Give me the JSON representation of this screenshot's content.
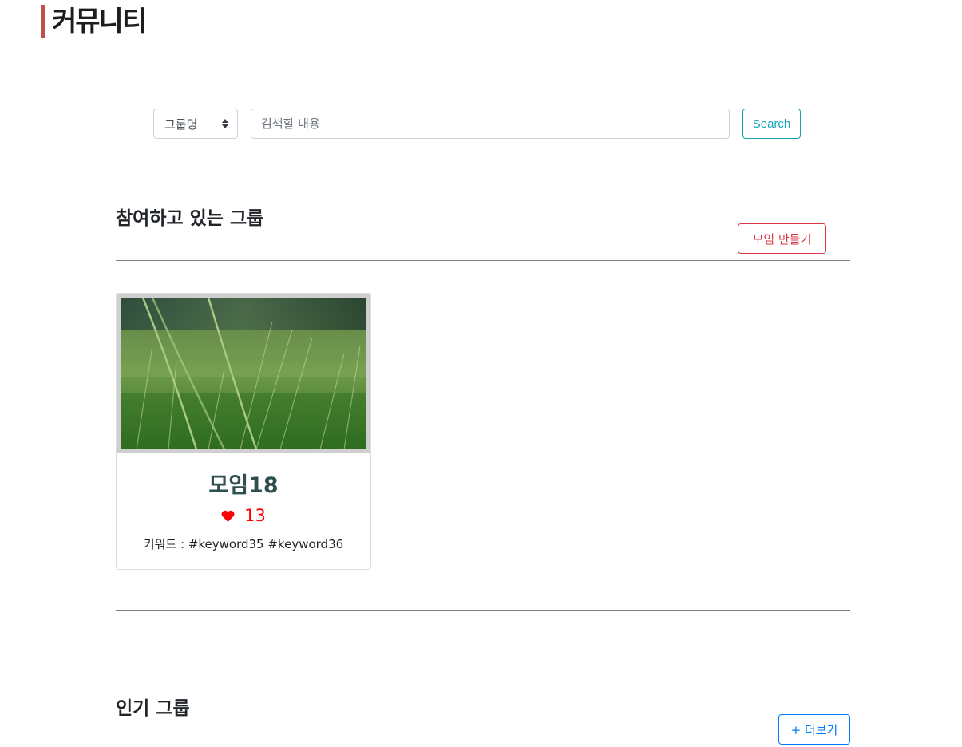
{
  "header": {
    "title": "커뮤니티"
  },
  "search": {
    "filter_selected": "그룹명",
    "placeholder": "검색할 내용",
    "value": "",
    "button_label": "Search"
  },
  "joined_section": {
    "heading": "참여하고 있는 그룹",
    "create_button_label": "모임 만들기",
    "groups": [
      {
        "name": "모임18",
        "likes": "13",
        "keywords": "키워드 : #keyword35 #keyword36",
        "image": "grass-field-photo"
      }
    ]
  },
  "popular_section": {
    "heading": "인기 그룹",
    "more_button_label": "+ 더보기"
  },
  "colors": {
    "title_accent": "#c0504d",
    "search_button": "#17a2b8",
    "create_button": "#dc3545",
    "more_button": "#007bff",
    "likes": "#ff0000",
    "card_title": "#2f4f4f"
  },
  "icons": {
    "like": "heart-icon",
    "select": "chevron-updown-icon"
  }
}
